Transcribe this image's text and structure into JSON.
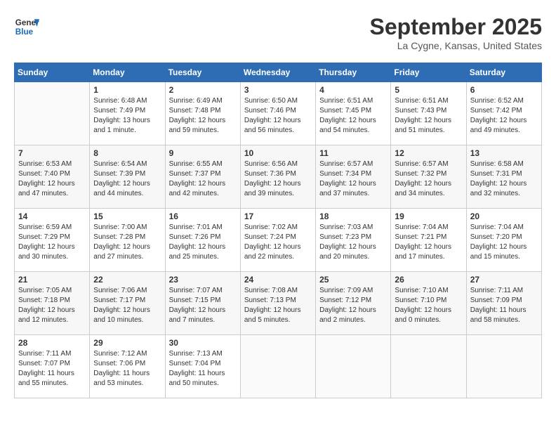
{
  "header": {
    "logo_line1": "General",
    "logo_line2": "Blue",
    "month": "September 2025",
    "location": "La Cygne, Kansas, United States"
  },
  "days_of_week": [
    "Sunday",
    "Monday",
    "Tuesday",
    "Wednesday",
    "Thursday",
    "Friday",
    "Saturday"
  ],
  "weeks": [
    [
      {
        "num": "",
        "sunrise": "",
        "sunset": "",
        "daylight": ""
      },
      {
        "num": "1",
        "sunrise": "Sunrise: 6:48 AM",
        "sunset": "Sunset: 7:49 PM",
        "daylight": "Daylight: 13 hours and 1 minute."
      },
      {
        "num": "2",
        "sunrise": "Sunrise: 6:49 AM",
        "sunset": "Sunset: 7:48 PM",
        "daylight": "Daylight: 12 hours and 59 minutes."
      },
      {
        "num": "3",
        "sunrise": "Sunrise: 6:50 AM",
        "sunset": "Sunset: 7:46 PM",
        "daylight": "Daylight: 12 hours and 56 minutes."
      },
      {
        "num": "4",
        "sunrise": "Sunrise: 6:51 AM",
        "sunset": "Sunset: 7:45 PM",
        "daylight": "Daylight: 12 hours and 54 minutes."
      },
      {
        "num": "5",
        "sunrise": "Sunrise: 6:51 AM",
        "sunset": "Sunset: 7:43 PM",
        "daylight": "Daylight: 12 hours and 51 minutes."
      },
      {
        "num": "6",
        "sunrise": "Sunrise: 6:52 AM",
        "sunset": "Sunset: 7:42 PM",
        "daylight": "Daylight: 12 hours and 49 minutes."
      }
    ],
    [
      {
        "num": "7",
        "sunrise": "Sunrise: 6:53 AM",
        "sunset": "Sunset: 7:40 PM",
        "daylight": "Daylight: 12 hours and 47 minutes."
      },
      {
        "num": "8",
        "sunrise": "Sunrise: 6:54 AM",
        "sunset": "Sunset: 7:39 PM",
        "daylight": "Daylight: 12 hours and 44 minutes."
      },
      {
        "num": "9",
        "sunrise": "Sunrise: 6:55 AM",
        "sunset": "Sunset: 7:37 PM",
        "daylight": "Daylight: 12 hours and 42 minutes."
      },
      {
        "num": "10",
        "sunrise": "Sunrise: 6:56 AM",
        "sunset": "Sunset: 7:36 PM",
        "daylight": "Daylight: 12 hours and 39 minutes."
      },
      {
        "num": "11",
        "sunrise": "Sunrise: 6:57 AM",
        "sunset": "Sunset: 7:34 PM",
        "daylight": "Daylight: 12 hours and 37 minutes."
      },
      {
        "num": "12",
        "sunrise": "Sunrise: 6:57 AM",
        "sunset": "Sunset: 7:32 PM",
        "daylight": "Daylight: 12 hours and 34 minutes."
      },
      {
        "num": "13",
        "sunrise": "Sunrise: 6:58 AM",
        "sunset": "Sunset: 7:31 PM",
        "daylight": "Daylight: 12 hours and 32 minutes."
      }
    ],
    [
      {
        "num": "14",
        "sunrise": "Sunrise: 6:59 AM",
        "sunset": "Sunset: 7:29 PM",
        "daylight": "Daylight: 12 hours and 30 minutes."
      },
      {
        "num": "15",
        "sunrise": "Sunrise: 7:00 AM",
        "sunset": "Sunset: 7:28 PM",
        "daylight": "Daylight: 12 hours and 27 minutes."
      },
      {
        "num": "16",
        "sunrise": "Sunrise: 7:01 AM",
        "sunset": "Sunset: 7:26 PM",
        "daylight": "Daylight: 12 hours and 25 minutes."
      },
      {
        "num": "17",
        "sunrise": "Sunrise: 7:02 AM",
        "sunset": "Sunset: 7:24 PM",
        "daylight": "Daylight: 12 hours and 22 minutes."
      },
      {
        "num": "18",
        "sunrise": "Sunrise: 7:03 AM",
        "sunset": "Sunset: 7:23 PM",
        "daylight": "Daylight: 12 hours and 20 minutes."
      },
      {
        "num": "19",
        "sunrise": "Sunrise: 7:04 AM",
        "sunset": "Sunset: 7:21 PM",
        "daylight": "Daylight: 12 hours and 17 minutes."
      },
      {
        "num": "20",
        "sunrise": "Sunrise: 7:04 AM",
        "sunset": "Sunset: 7:20 PM",
        "daylight": "Daylight: 12 hours and 15 minutes."
      }
    ],
    [
      {
        "num": "21",
        "sunrise": "Sunrise: 7:05 AM",
        "sunset": "Sunset: 7:18 PM",
        "daylight": "Daylight: 12 hours and 12 minutes."
      },
      {
        "num": "22",
        "sunrise": "Sunrise: 7:06 AM",
        "sunset": "Sunset: 7:17 PM",
        "daylight": "Daylight: 12 hours and 10 minutes."
      },
      {
        "num": "23",
        "sunrise": "Sunrise: 7:07 AM",
        "sunset": "Sunset: 7:15 PM",
        "daylight": "Daylight: 12 hours and 7 minutes."
      },
      {
        "num": "24",
        "sunrise": "Sunrise: 7:08 AM",
        "sunset": "Sunset: 7:13 PM",
        "daylight": "Daylight: 12 hours and 5 minutes."
      },
      {
        "num": "25",
        "sunrise": "Sunrise: 7:09 AM",
        "sunset": "Sunset: 7:12 PM",
        "daylight": "Daylight: 12 hours and 2 minutes."
      },
      {
        "num": "26",
        "sunrise": "Sunrise: 7:10 AM",
        "sunset": "Sunset: 7:10 PM",
        "daylight": "Daylight: 12 hours and 0 minutes."
      },
      {
        "num": "27",
        "sunrise": "Sunrise: 7:11 AM",
        "sunset": "Sunset: 7:09 PM",
        "daylight": "Daylight: 11 hours and 58 minutes."
      }
    ],
    [
      {
        "num": "28",
        "sunrise": "Sunrise: 7:11 AM",
        "sunset": "Sunset: 7:07 PM",
        "daylight": "Daylight: 11 hours and 55 minutes."
      },
      {
        "num": "29",
        "sunrise": "Sunrise: 7:12 AM",
        "sunset": "Sunset: 7:06 PM",
        "daylight": "Daylight: 11 hours and 53 minutes."
      },
      {
        "num": "30",
        "sunrise": "Sunrise: 7:13 AM",
        "sunset": "Sunset: 7:04 PM",
        "daylight": "Daylight: 11 hours and 50 minutes."
      },
      {
        "num": "",
        "sunrise": "",
        "sunset": "",
        "daylight": ""
      },
      {
        "num": "",
        "sunrise": "",
        "sunset": "",
        "daylight": ""
      },
      {
        "num": "",
        "sunrise": "",
        "sunset": "",
        "daylight": ""
      },
      {
        "num": "",
        "sunrise": "",
        "sunset": "",
        "daylight": ""
      }
    ]
  ]
}
